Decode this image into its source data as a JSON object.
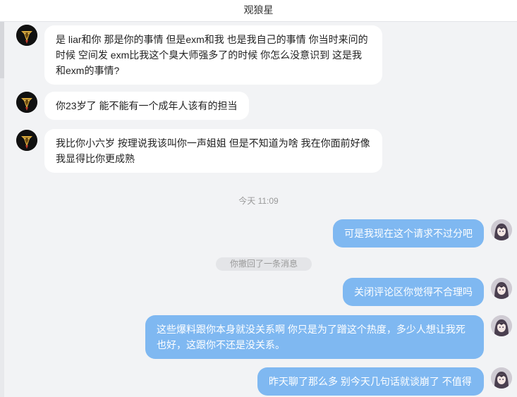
{
  "window": {
    "title": "观狼星"
  },
  "messages": [
    {
      "direction": "in",
      "text": "是 liar和你 那是你的事情 但是exm和我 也是我自己的事情 你当时来问的时候 空间发 exm比我这个臭大师强多了的时候 你怎么没意识到 这是我和exm的事情?"
    },
    {
      "direction": "in",
      "text": "你23岁了 能不能有一个成年人该有的担当"
    },
    {
      "direction": "in",
      "text": "我比你小六岁 按理说我该叫你一声姐姐 但是不知道为啥 我在你面前好像我显得比你更成熟"
    },
    {
      "direction": "out",
      "text": "可是我现在这个请求不过分吧"
    },
    {
      "direction": "out",
      "text": "关闭评论区你觉得不合理吗"
    },
    {
      "direction": "out",
      "text": "这些爆料跟你本身就没关系啊 你只是为了蹭这个热度，多少人想让我死也好，这跟你不还是没关系。"
    },
    {
      "direction": "out",
      "text": "昨天聊了那么多 别今天几句话就谈崩了 不值得"
    }
  ],
  "timestamp": "今天 11:09",
  "recall_notice": "你撤回了一条消息",
  "colors": {
    "outgoing_bubble": "#7fb8f1",
    "incoming_bubble": "#ffffff",
    "background": "#f2f3f5"
  },
  "icons": {
    "contact_avatar": "dark-emblem-avatar",
    "self_avatar": "anime-girl-avatar"
  }
}
